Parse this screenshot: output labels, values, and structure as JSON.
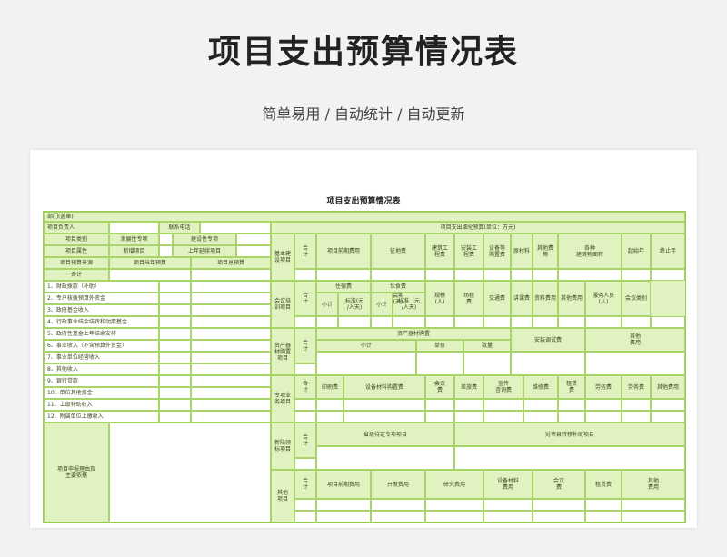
{
  "header": {
    "title": "项目支出预算情况表",
    "subtitle": "简单易用  /  自动统计  /  自动更新"
  },
  "sheet": {
    "title": "项目支出预算情况表",
    "dept": "部门(盖章)",
    "leader": "项目负责人",
    "contact": "联系电话",
    "budget_header": "项目支出细化预算(单位：万元)",
    "category_label": "项目类别",
    "category_opt1": "发展性专项",
    "category_opt2": "建设性专项",
    "attr_label": "项目属性",
    "attr_opt1": "新增项目",
    "attr_opt2": "上年延续项目",
    "fund_label": "项目预算来源",
    "fund_opt1": "项目当年预算",
    "fund_opt2": "项目总预算",
    "total_label": "合计",
    "sources": [
      "1、财政拨款（补助）",
      "2、专户核拨预算外资金",
      "3、政府基金收入",
      "4、行政事业结余结转和动用基金",
      "5、政府性基金上年结余安排",
      "6、事业收入（不含预算外资金）",
      "7、事业单位经营收入",
      "8、其他收入",
      "9、银行贷款",
      "10、单位其他资金",
      "11、上级补助收入",
      "12、附属单位上缴收入"
    ],
    "reason_label": "项目申报理由及\n主要依据",
    "groups": {
      "g1": {
        "label": "基本建\n设项目",
        "heads": [
          "合\n计",
          "项目前期费用",
          "征地费",
          "建筑工\n程费",
          "安装工\n程费",
          "设备等\n购置费",
          "原材料",
          "其他费\n用",
          "各种\n建筑物面积",
          "起始年",
          "终止年"
        ]
      },
      "g2": {
        "label": "会议培\n训项目",
        "heads": [
          "合\n计",
          "住宿费",
          "伙食费",
          "会期\n(天)",
          "规模\n(人)",
          "场租\n费",
          "交通费",
          "讲课费",
          "资料费用",
          "其他费用",
          "服务人员\n(人)",
          "会议类别"
        ],
        "sub": [
          "小计",
          "标准(元\n/人天)",
          "小计",
          "标准（元\n/人天)"
        ]
      },
      "g3": {
        "label": "资产器\n材购置\n项目",
        "heads": [
          "合\n计",
          "资产器材购置",
          "安装调试费",
          "其他\n费用"
        ],
        "sub": [
          "小计",
          "单价",
          "数量"
        ]
      },
      "g4": {
        "label": "专项业\n务项目",
        "heads": [
          "合\n计",
          "印刷费",
          "设备材料购置费",
          "会议\n费",
          "差旅费",
          "宣传\n咨询费",
          "维修费",
          "租赁\n费",
          "劳务费",
          "劳务费",
          "其他费用"
        ]
      },
      "g5": {
        "label": "新陆领\n标项目",
        "heads": [
          "合\n计",
          "省级待定专项项目",
          "对市县转移补助项目"
        ]
      },
      "g6": {
        "label": "其他\n项目",
        "heads": [
          "合\n计",
          "项目前期费用",
          "开发费用",
          "研究费用",
          "设备材料\n费用",
          "会议\n费",
          "租赁费",
          "其他\n费用"
        ]
      }
    }
  }
}
